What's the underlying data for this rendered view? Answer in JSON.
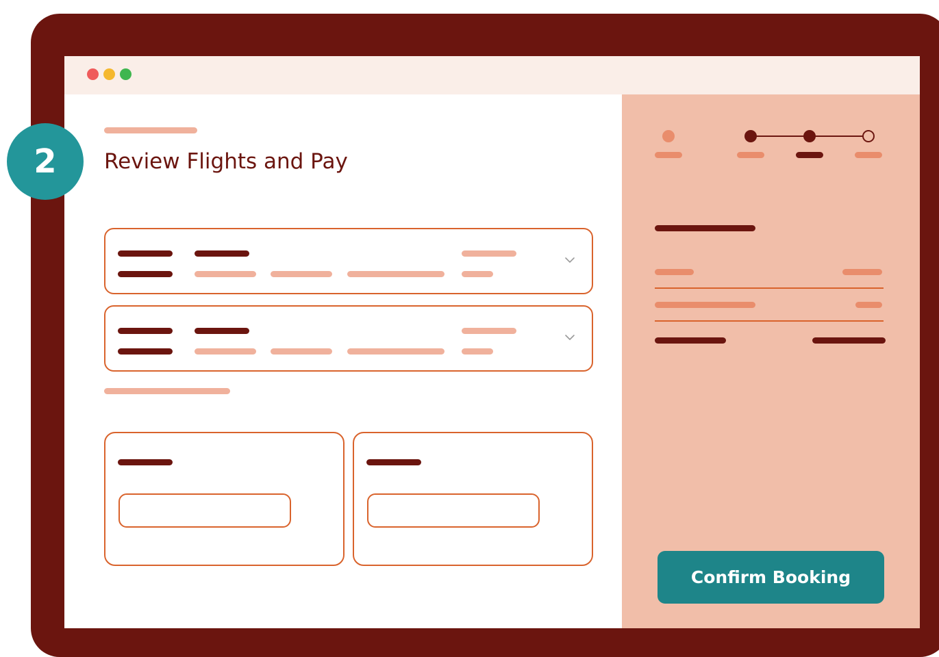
{
  "window": {
    "controls": [
      "close",
      "minimize",
      "maximize"
    ]
  },
  "step": {
    "number": "2",
    "title": "Review Flights and Pay"
  },
  "flights": [
    {
      "expand_icon": "chevron-down-icon"
    },
    {
      "expand_icon": "chevron-down-icon"
    }
  ],
  "summary": {
    "progress": {
      "steps": 4,
      "completed": 3,
      "current_step": 3
    }
  },
  "actions": {
    "confirm_label": "Confirm Booking"
  },
  "colors": {
    "frame": "#6b150f",
    "accent": "#23969a",
    "button": "#1e8589",
    "border": "#d9632c",
    "sidebar": "#f1bea9"
  }
}
